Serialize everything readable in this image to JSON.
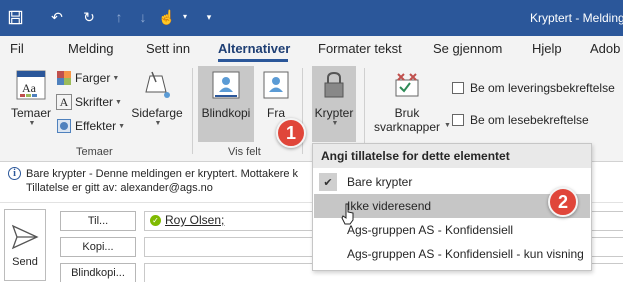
{
  "window": {
    "title": "Kryptert  -  Melding"
  },
  "quick_access": {
    "icons": [
      "save-icon",
      "undo-icon",
      "redo-icon",
      "arrow-up-icon",
      "arrow-down-icon",
      "touch-mode-icon",
      "customize-icon"
    ]
  },
  "tabs": [
    {
      "label": "Fil"
    },
    {
      "label": "Melding"
    },
    {
      "label": "Sett inn"
    },
    {
      "label": "Alternativer"
    },
    {
      "label": "Formater tekst"
    },
    {
      "label": "Se gjennom"
    },
    {
      "label": "Hjelp"
    },
    {
      "label": "Adob"
    }
  ],
  "ribbon": {
    "themes": {
      "temaer_label": "Temaer",
      "farger_label": "Farger",
      "skrifter_label": "Skrifter",
      "effekter_label": "Effekter",
      "sidefarge_label": "Sidefarge",
      "group_label": "Temaer"
    },
    "show_fields": {
      "blindkopi_label": "Blindkopi",
      "fra_label": "Fra",
      "group_label": "Vis felt"
    },
    "encrypt": {
      "krypter_label": "Krypter"
    },
    "tracking": {
      "bruk_line1": "Bruk",
      "bruk_line2": "svarknapper",
      "delivery_label": "Be om leveringsbekreftelse",
      "read_label": "Be om lesebekreftelse"
    }
  },
  "infobar": {
    "line1": "Bare krypter - Denne meldingen er kryptert. Mottakere k",
    "line2": "Tillatelse er gitt av: alexander@ags.no"
  },
  "compose": {
    "send_label": "Send",
    "to_label": "Til...",
    "cc_label": "Kopi...",
    "bcc_label": "Blindkopi...",
    "to_recipient": "Roy Olsen;"
  },
  "menu": {
    "header": "Angi tillatelse for dette elementet",
    "items": [
      {
        "label": "Bare krypter",
        "checked": true
      },
      {
        "label": "Ikke videresend",
        "hovered": true
      },
      {
        "label": "Ags-gruppen AS - Konfidensiell"
      },
      {
        "label": "Ags-gruppen AS - Konfidensiell - kun visning"
      }
    ]
  },
  "callouts": {
    "one": "1",
    "two": "2",
    "color": "#e0463a"
  },
  "colors": {
    "titlebar": "#2b579a",
    "ribbon_bg": "#f3f3f3",
    "pressed_bg": "#c8c8c8"
  }
}
